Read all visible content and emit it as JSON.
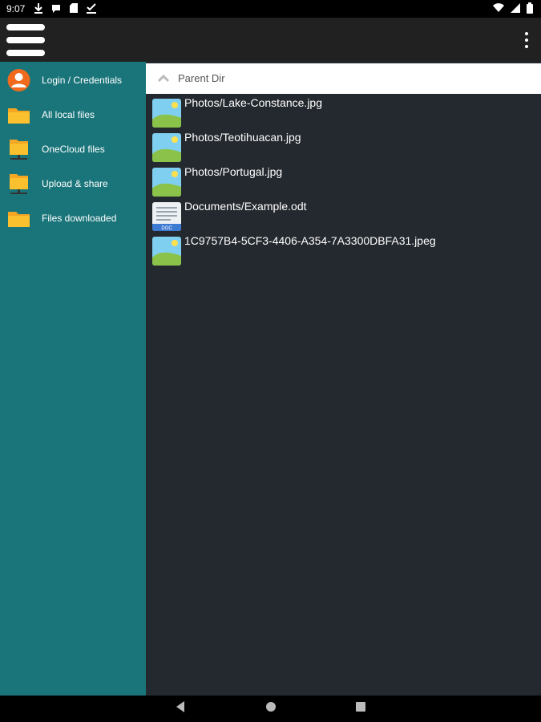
{
  "status_bar": {
    "time": "9:07",
    "left_icons": [
      "download-icon",
      "chat-icon",
      "sd-card-icon",
      "task-done-icon"
    ],
    "right_icons": [
      "wifi-icon",
      "signal-icon",
      "battery-icon"
    ]
  },
  "toolbar": {
    "menu_icon": "hamburger-icon",
    "overflow_icon": "more-vert-icon"
  },
  "sidebar": {
    "items": [
      {
        "label": "Login / Credentials",
        "icon": "user-account-icon"
      },
      {
        "label": "All local files",
        "icon": "folder-icon"
      },
      {
        "label": "OneCloud files",
        "icon": "network-folder-icon"
      },
      {
        "label": "Upload & share",
        "icon": "network-folder-icon"
      },
      {
        "label": "Files downloaded",
        "icon": "folder-icon"
      }
    ]
  },
  "main": {
    "parent_dir_label": "Parent Dir",
    "files": [
      {
        "name": "Photos/Lake-Constance.jpg",
        "icon": "image-file-icon"
      },
      {
        "name": "Photos/Teotihuacan.jpg",
        "icon": "image-file-icon"
      },
      {
        "name": "Photos/Portugal.jpg",
        "icon": "image-file-icon"
      },
      {
        "name": "Documents/Example.odt",
        "icon": "document-file-icon",
        "badge": "DOC"
      },
      {
        "name": "1C9757B4-5CF3-4406-A354-7A3300DBFA31.jpeg",
        "icon": "image-file-icon"
      }
    ]
  },
  "colors": {
    "sidebar": "#1a757a",
    "main_bg": "#24292f",
    "toolbar": "#212121",
    "folder": "#f5a623",
    "accent_orange": "#f26b1d"
  }
}
